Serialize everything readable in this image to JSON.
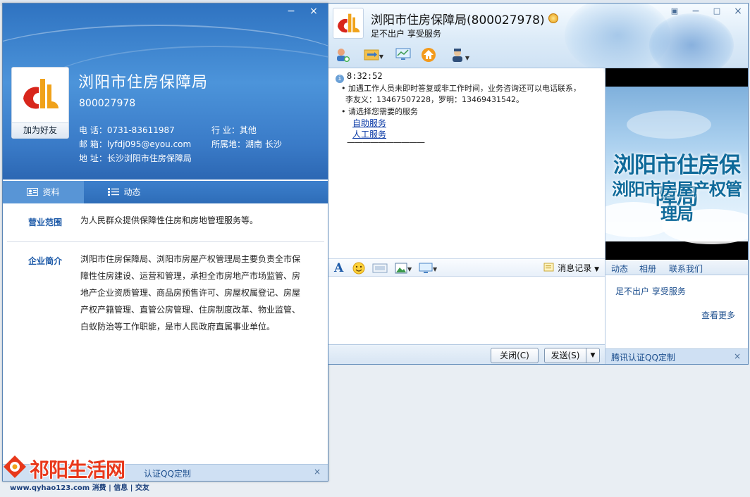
{
  "profile": {
    "name": "浏阳市住房保障局",
    "number": "800027978",
    "add_friend": "加为好友",
    "phone": "电  话：0731-83611987",
    "email": "邮  箱：lyfdj095@eyou.com",
    "address": "地  址：长沙浏阳市住房保障局",
    "industry": "行  业：其他",
    "location": "所属地：湖南 长沙",
    "tabs": [
      "资料",
      "动态"
    ],
    "scope_label": "营业范围",
    "scope_text": "为人民群众提供保障性住房和房地管理服务等。",
    "intro_label": "企业简介",
    "intro_text": "浏阳市住房保障局、浏阳市房屋产权管理局主要负责全市保障性住房建设、运营和管理，承担全市房地产市场监管、房地产企业资质管理、商品房预售许可、房屋权属登记、房屋产权产籍管理、直管公房管理、住房制度改革、物业监管、白蚁防治等工作职能，是市人民政府直属事业单位。",
    "bottom_text": "认证QQ定制",
    "close_glyph": "×",
    "minimize_glyph": "−"
  },
  "chat": {
    "title": "浏阳市住房保障局(800027978)",
    "subtitle": "足不出户  享受服务",
    "time": "8:32:52",
    "messages": [
      "加遇工作人员未即时答复或非工作时间，业务咨询还可以电话联系，",
      "李友义：13467507228，罗明：13469431542。",
      "请选择您需要的服务"
    ],
    "links": [
      "自助服务",
      "人工服务"
    ],
    "separator": "——————————",
    "history_label": "消息记录",
    "close_btn": "关闭(C)",
    "send_btn": "发送(S)",
    "font_glyph": "A",
    "smile_glyph": "☺"
  },
  "side": {
    "banner_line1": "浏阳市住房保障局",
    "banner_line2": "浏阳市房屋产权管理局",
    "tabs": [
      "动态",
      "相册",
      "联系我们"
    ],
    "slogan": "足不出户  享受服务",
    "more": "查看更多",
    "bottom_text": "腾讯认证QQ定制",
    "close_glyph": "×"
  },
  "watermark": {
    "brand": "祁阳生活网",
    "url": "www.qyhao123.com 消费 | 信息 | 交友"
  },
  "colors": {
    "accent": "#2f73c1",
    "link": "#0a3aa6",
    "brand_red": "#e8381b"
  }
}
